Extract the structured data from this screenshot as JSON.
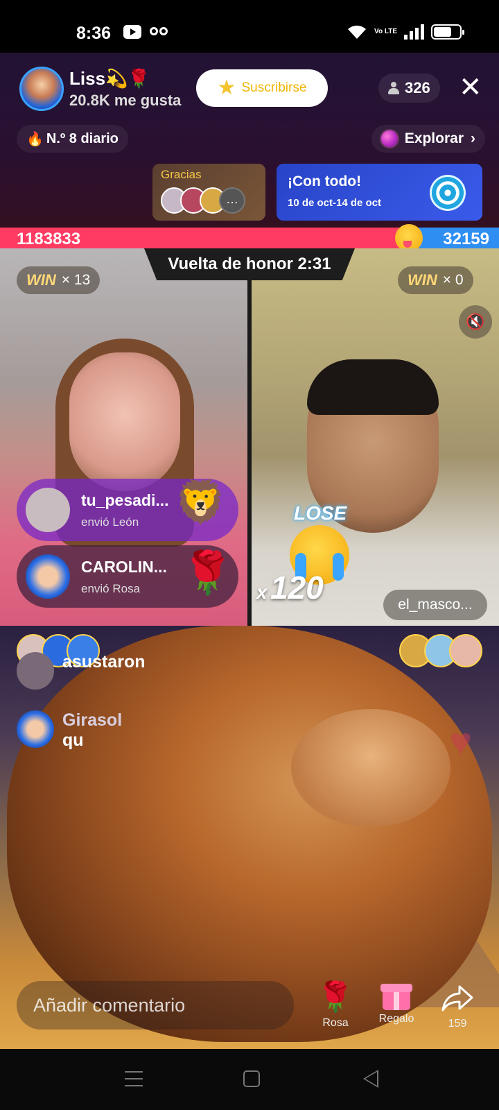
{
  "status_bar": {
    "time": "8:36",
    "network": "Vo LTE"
  },
  "header": {
    "host_name": "Liss💫🌹",
    "likes": "20.8K me gusta",
    "subscribe_label": "Suscribirse",
    "viewer_count": "326",
    "daily_rank": "N.º 8 diario",
    "explore_label": "Explorar"
  },
  "thanks_card": {
    "title": "Gracias"
  },
  "promo_card": {
    "title": "¡Con todo!",
    "dates": "10 de oct-14 de oct"
  },
  "battle": {
    "left_score": "1183833",
    "right_score": "32159",
    "timer": "Vuelta de honor 2:31",
    "left_wins": "× 13",
    "right_wins": "× 0",
    "win_label": "WIN",
    "lose_label": "LOSE",
    "combo_prefix": "x",
    "combo_count": "120",
    "opponent_name": "el_masco..."
  },
  "gift_feed": [
    {
      "user": "tu_pesadi...",
      "action": "envió León"
    },
    {
      "user": "CAROLIN...",
      "action": "envió Rosa"
    }
  ],
  "comments": [
    {
      "user": "",
      "text": "asustaron"
    },
    {
      "user": "Girasol",
      "text": "qu"
    }
  ],
  "bottom_bar": {
    "comment_placeholder": "Añadir comentario",
    "rose_label": "Rosa",
    "gift_label": "Regalo",
    "share_count": "159"
  },
  "colors": {
    "score_red": "#ff3b62",
    "score_blue": "#2f8ef2",
    "subscribe_text": "#f0b400"
  }
}
